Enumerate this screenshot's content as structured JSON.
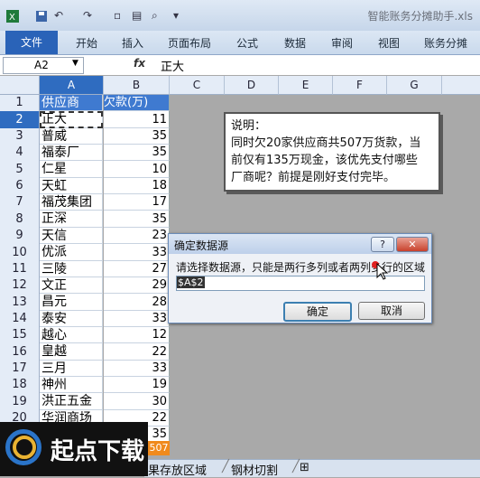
{
  "window": {
    "title": "智能账务分摊助手.xls"
  },
  "ribbon": {
    "tabs": [
      "文件",
      "开始",
      "插入",
      "页面布局",
      "公式",
      "数据",
      "审阅",
      "视图",
      "账务分摊"
    ]
  },
  "formula_bar": {
    "name_box": "A2",
    "fx": "fx",
    "content": "正大"
  },
  "columns": [
    "A",
    "B",
    "C",
    "D",
    "E",
    "F",
    "G"
  ],
  "table": {
    "header": [
      "供应商",
      "欠款(万)"
    ],
    "rows": [
      [
        "正大",
        "11"
      ],
      [
        "普威",
        "35"
      ],
      [
        "福泰厂",
        "35"
      ],
      [
        "仁星",
        "10"
      ],
      [
        "天虹",
        "18"
      ],
      [
        "福茂集团",
        "17"
      ],
      [
        "正深",
        "35"
      ],
      [
        "天信",
        "23"
      ],
      [
        "优派",
        "33"
      ],
      [
        "三陵",
        "27"
      ],
      [
        "文正",
        "29"
      ],
      [
        "昌元",
        "28"
      ],
      [
        "泰安",
        "33"
      ],
      [
        "越心",
        "12"
      ],
      [
        "皇越",
        "22"
      ],
      [
        "三月",
        "33"
      ],
      [
        "神州",
        "19"
      ],
      [
        "洪正五金",
        "30"
      ],
      [
        "华润商场",
        "22"
      ],
      [
        "",
        "35"
      ]
    ],
    "total": "507"
  },
  "note": {
    "line1": "说明：",
    "line2": "同时欠20家供应商共507万货款，当",
    "line3": "前仅有135万现金，该优先支付哪些",
    "line4": "厂商呢？前提是刚好支付完毕。"
  },
  "dialog": {
    "title": "确定数据源",
    "help": "?",
    "close": "✕",
    "message": "请选择数据源，只能是两行多列或者两列多行的区域",
    "input_value": "$A$2",
    "ok": "确定",
    "cancel": "取消"
  },
  "sheet_tabs": {
    "tab1": "果存放区域",
    "tab2": "钢材切割"
  },
  "logo": {
    "text": "起点下载"
  }
}
